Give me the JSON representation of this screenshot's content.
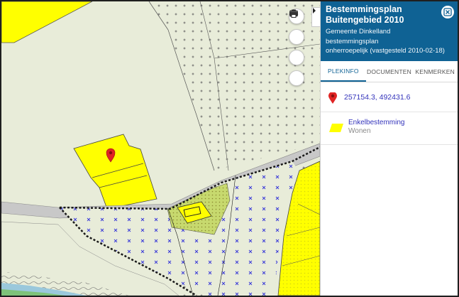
{
  "panel": {
    "title": "Bestemmingsplan Buitengebied 2010",
    "municipality": "Gemeente Dinkelland",
    "plan_type": "bestemmingsplan",
    "status": "onherroepelijk (vastgesteld 2010-02-18)"
  },
  "tabs": [
    {
      "label": "PLEKINFO",
      "active": true
    },
    {
      "label": "DOCUMENTEN",
      "active": false
    },
    {
      "label": "KENMERKEN",
      "active": false
    }
  ],
  "location": {
    "coordinates": "257154.3, 492431.6",
    "icon": "map-pin-icon",
    "color": "#e02424"
  },
  "legend": {
    "category": "Enkelbestemming",
    "value": "Wonen",
    "swatch_color": "#ffff00"
  },
  "map_tools": [
    {
      "name": "layers",
      "icon": "layers-icon"
    },
    {
      "name": "measure",
      "icon": "ruler-icon"
    },
    {
      "name": "legend",
      "icon": "list-icon"
    },
    {
      "name": "print",
      "icon": "printer-icon"
    }
  ],
  "colors": {
    "header": "#0f6294",
    "wonen": "#ffff00",
    "road": "#c8c8c8",
    "agrarisch": "#e8ecd9"
  }
}
